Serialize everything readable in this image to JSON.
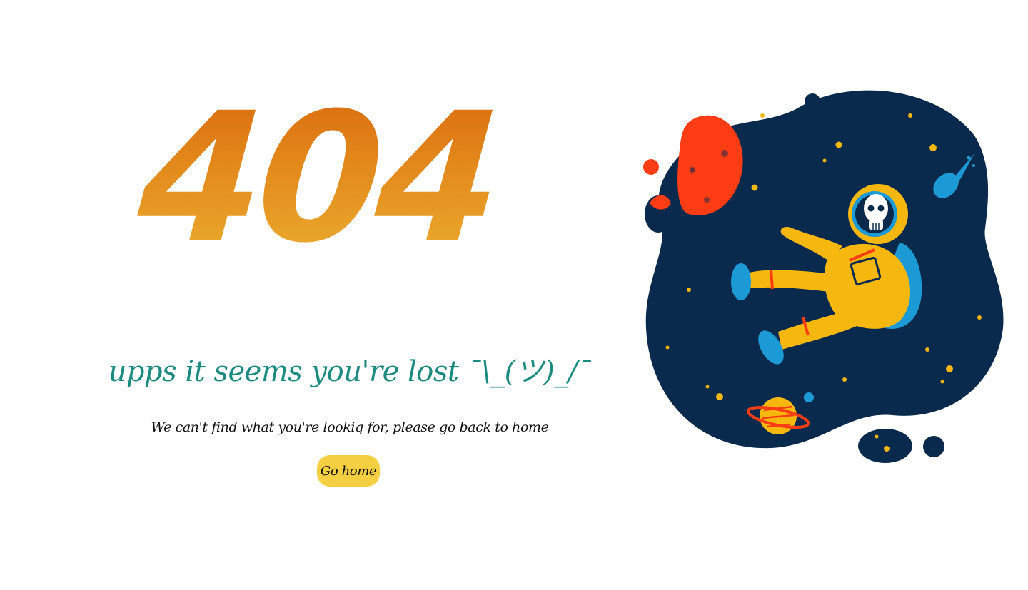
{
  "error": {
    "code": "404",
    "headline": "upps it seems you're lost ¯\\_(ツ)_/¯",
    "message": "We can't find what you're lookiq for, please go back to home",
    "home_button_label": "Go home"
  },
  "colors": {
    "code_gradient_top": "#d8650c",
    "code_gradient_bottom": "#ecb333",
    "headline": "#1b8a80",
    "button_bg": "#f4cf42",
    "space": "#0a2a4d",
    "planet_red": "#ff3d14",
    "astronaut_suit": "#f6b70f",
    "accent_blue": "#1c9ad6"
  },
  "illustration": {
    "icon": "astronaut-in-space-illustration"
  }
}
